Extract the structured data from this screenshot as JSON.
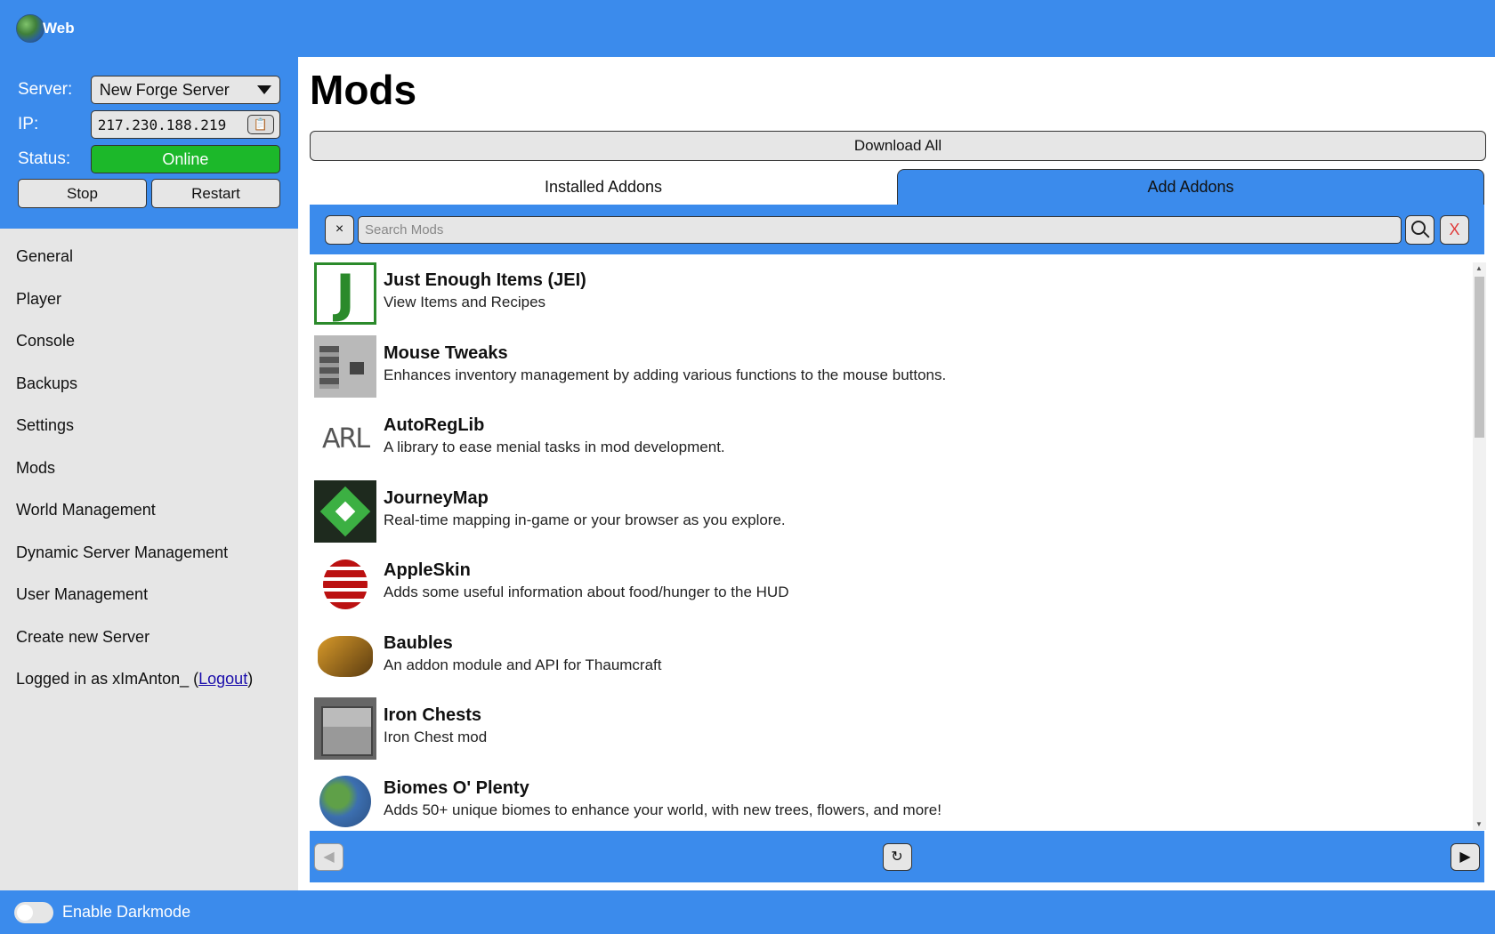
{
  "app": {
    "title": "Web"
  },
  "server_panel": {
    "server_label": "Server:",
    "server_value": "New Forge Server",
    "ip_label": "IP:",
    "ip_value": "217.230.188.219",
    "status_label": "Status:",
    "status_value": "Online",
    "stop_label": "Stop",
    "restart_label": "Restart",
    "colors": {
      "panel": "#3b8bec",
      "online": "#1cb82a"
    }
  },
  "nav": {
    "items": [
      {
        "label": "General"
      },
      {
        "label": "Player"
      },
      {
        "label": "Console"
      },
      {
        "label": "Backups"
      },
      {
        "label": "Settings"
      },
      {
        "label": "Mods"
      },
      {
        "label": "World Management"
      },
      {
        "label": "Dynamic Server Management"
      },
      {
        "label": "User Management"
      },
      {
        "label": "Create new Server"
      }
    ],
    "logged_in_prefix": "Logged in as xImAnton_ (",
    "logout_label": "Logout",
    "logged_in_suffix": ")"
  },
  "footer": {
    "darkmode_label": "Enable Darkmode",
    "darkmode_on": false
  },
  "main": {
    "title": "Mods",
    "download_all_label": "Download All",
    "tabs": [
      {
        "label": "Installed Addons",
        "active": false
      },
      {
        "label": "Add Addons",
        "active": true
      }
    ],
    "search": {
      "placeholder": "Search Mods",
      "clear_label": "×",
      "cancel_label": "X"
    },
    "mods": [
      {
        "name": "Just Enough Items (JEI)",
        "description": "View Items and Recipes",
        "icon": "jei-icon"
      },
      {
        "name": "Mouse Tweaks",
        "description": "Enhances inventory management by adding various functions to the mouse buttons.",
        "icon": "mouse-tweaks-icon"
      },
      {
        "name": "AutoRegLib",
        "description": "A library to ease menial tasks in mod development.",
        "icon": "autoreglib-icon"
      },
      {
        "name": "JourneyMap",
        "description": "Real-time mapping in-game or your browser as you explore.",
        "icon": "journeymap-icon"
      },
      {
        "name": "AppleSkin",
        "description": "Adds some useful information about food/hunger to the HUD",
        "icon": "appleskin-icon"
      },
      {
        "name": "Baubles",
        "description": "An addon module and API for Thaumcraft",
        "icon": "baubles-icon"
      },
      {
        "name": "Iron Chests",
        "description": "Iron Chest mod",
        "icon": "iron-chests-icon"
      },
      {
        "name": "Biomes O' Plenty",
        "description": "Adds 50+ unique biomes to enhance your world, with new trees, flowers, and more!",
        "icon": "biomes-o-plenty-icon"
      }
    ],
    "pager": {
      "prev": "◀",
      "refresh": "↻",
      "next": "▶"
    },
    "icon_glyphs": {
      "jei": "J",
      "arl": "ARL"
    }
  }
}
